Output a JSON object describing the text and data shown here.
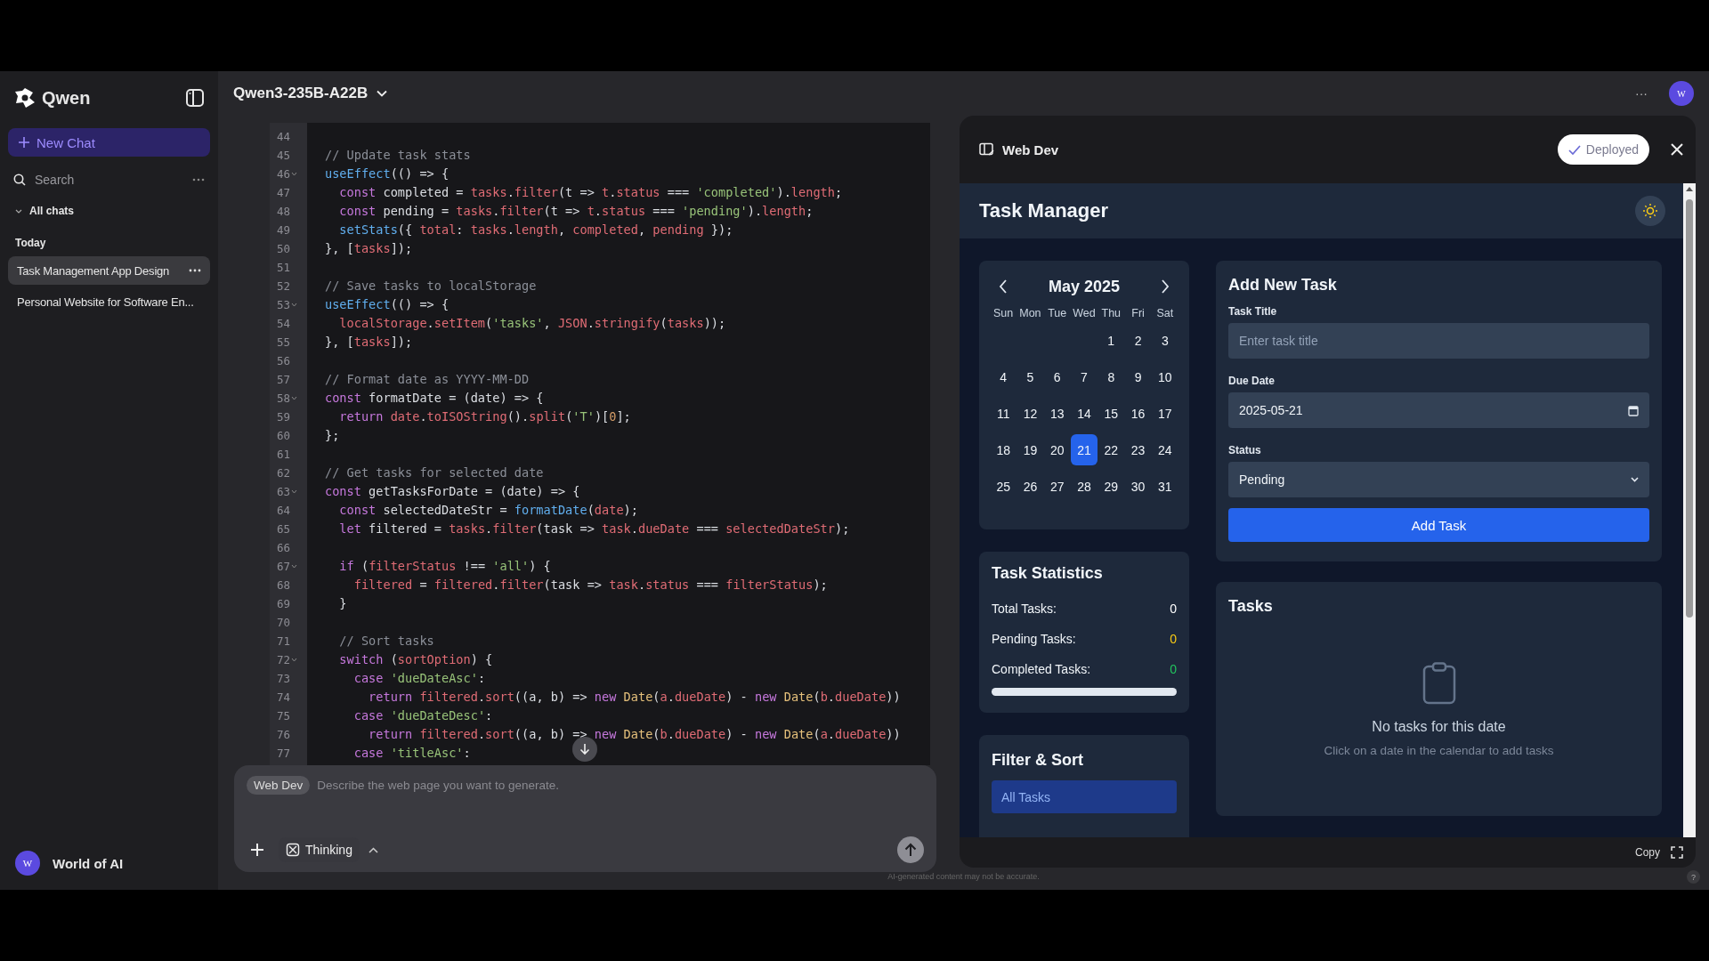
{
  "sidebar": {
    "brand": "Qwen",
    "new_chat": "New Chat",
    "search": {
      "placeholder": "Search"
    },
    "all_chats": "All chats",
    "section": "Today",
    "chats": [
      {
        "title": "Task Management App Design",
        "selected": true
      },
      {
        "title": "Personal Website for Software En...",
        "selected": false
      }
    ],
    "user": {
      "initial": "W",
      "name": "World of AI"
    }
  },
  "header": {
    "model": "Qwen3-235B-A22B",
    "more": "···",
    "avatar": "W"
  },
  "code": {
    "lines": [
      {
        "number": "44",
        "foldable": false
      },
      {
        "number": "45",
        "foldable": false,
        "tokens": [
          {
            "kind": "comment",
            "text": "// Update task stats"
          }
        ]
      },
      {
        "number": "46",
        "foldable": true,
        "tokens": [
          {
            "kind": "func",
            "text": "useEffect"
          },
          {
            "kind": "plain",
            "text": "(() => {"
          }
        ]
      },
      {
        "number": "47",
        "foldable": false,
        "tokens": [
          {
            "kind": "keyword",
            "text": "  const"
          },
          {
            "kind": "plain",
            "text": " completed = "
          },
          {
            "kind": "var",
            "text": "tasks"
          },
          {
            "kind": "plain",
            "text": "."
          },
          {
            "kind": "var",
            "text": "filter"
          },
          {
            "kind": "plain",
            "text": "(t => "
          },
          {
            "kind": "var",
            "text": "t"
          },
          {
            "kind": "plain",
            "text": "."
          },
          {
            "kind": "var",
            "text": "status"
          },
          {
            "kind": "plain",
            "text": " === "
          },
          {
            "kind": "string",
            "text": "'completed'"
          },
          {
            "kind": "plain",
            "text": ")."
          },
          {
            "kind": "var",
            "text": "length"
          },
          {
            "kind": "plain",
            "text": ";"
          }
        ]
      },
      {
        "number": "48",
        "foldable": false,
        "tokens": [
          {
            "kind": "keyword",
            "text": "  const"
          },
          {
            "kind": "plain",
            "text": " pending = "
          },
          {
            "kind": "var",
            "text": "tasks"
          },
          {
            "kind": "plain",
            "text": "."
          },
          {
            "kind": "var",
            "text": "filter"
          },
          {
            "kind": "plain",
            "text": "(t => "
          },
          {
            "kind": "var",
            "text": "t"
          },
          {
            "kind": "plain",
            "text": "."
          },
          {
            "kind": "var",
            "text": "status"
          },
          {
            "kind": "plain",
            "text": " === "
          },
          {
            "kind": "string",
            "text": "'pending'"
          },
          {
            "kind": "plain",
            "text": ")."
          },
          {
            "kind": "var",
            "text": "length"
          },
          {
            "kind": "plain",
            "text": ";"
          }
        ]
      },
      {
        "number": "49",
        "foldable": false,
        "tokens": [
          {
            "kind": "func",
            "text": "  setStats"
          },
          {
            "kind": "plain",
            "text": "({ "
          },
          {
            "kind": "var",
            "text": "total"
          },
          {
            "kind": "plain",
            "text": ": "
          },
          {
            "kind": "var",
            "text": "tasks"
          },
          {
            "kind": "plain",
            "text": "."
          },
          {
            "kind": "var",
            "text": "length"
          },
          {
            "kind": "plain",
            "text": ", "
          },
          {
            "kind": "var",
            "text": "completed"
          },
          {
            "kind": "plain",
            "text": ", "
          },
          {
            "kind": "var",
            "text": "pending"
          },
          {
            "kind": "plain",
            "text": " });"
          }
        ]
      },
      {
        "number": "50",
        "foldable": false,
        "tokens": [
          {
            "kind": "plain",
            "text": "}, ["
          },
          {
            "kind": "var",
            "text": "tasks"
          },
          {
            "kind": "plain",
            "text": "]);"
          }
        ]
      },
      {
        "number": "51",
        "foldable": false
      },
      {
        "number": "52",
        "foldable": false,
        "tokens": [
          {
            "kind": "comment",
            "text": "// Save tasks to localStorage"
          }
        ]
      },
      {
        "number": "53",
        "foldable": true,
        "tokens": [
          {
            "kind": "func",
            "text": "useEffect"
          },
          {
            "kind": "plain",
            "text": "(() => {"
          }
        ]
      },
      {
        "number": "54",
        "foldable": false,
        "tokens": [
          {
            "kind": "var",
            "text": "  localStorage"
          },
          {
            "kind": "plain",
            "text": "."
          },
          {
            "kind": "var",
            "text": "setItem"
          },
          {
            "kind": "plain",
            "text": "("
          },
          {
            "kind": "string",
            "text": "'tasks'"
          },
          {
            "kind": "plain",
            "text": ", "
          },
          {
            "kind": "var",
            "text": "JSON"
          },
          {
            "kind": "plain",
            "text": "."
          },
          {
            "kind": "var",
            "text": "stringify"
          },
          {
            "kind": "plain",
            "text": "("
          },
          {
            "kind": "var",
            "text": "tasks"
          },
          {
            "kind": "plain",
            "text": "));"
          }
        ]
      },
      {
        "number": "55",
        "foldable": false,
        "tokens": [
          {
            "kind": "plain",
            "text": "}, ["
          },
          {
            "kind": "var",
            "text": "tasks"
          },
          {
            "kind": "plain",
            "text": "]);"
          }
        ]
      },
      {
        "number": "56",
        "foldable": false
      },
      {
        "number": "57",
        "foldable": false,
        "tokens": [
          {
            "kind": "comment",
            "text": "// Format date as YYYY-MM-DD"
          }
        ]
      },
      {
        "number": "58",
        "foldable": true,
        "tokens": [
          {
            "kind": "keyword",
            "text": "const"
          },
          {
            "kind": "plain",
            "text": " formatDate = (date) => {"
          }
        ]
      },
      {
        "number": "59",
        "foldable": false,
        "tokens": [
          {
            "kind": "keyword",
            "text": "  return "
          },
          {
            "kind": "var",
            "text": "date"
          },
          {
            "kind": "plain",
            "text": "."
          },
          {
            "kind": "var",
            "text": "toISOString"
          },
          {
            "kind": "plain",
            "text": "()."
          },
          {
            "kind": "var",
            "text": "split"
          },
          {
            "kind": "plain",
            "text": "("
          },
          {
            "kind": "string",
            "text": "'T'"
          },
          {
            "kind": "plain",
            "text": ")["
          },
          {
            "kind": "number",
            "text": "0"
          },
          {
            "kind": "plain",
            "text": "];"
          }
        ]
      },
      {
        "number": "60",
        "foldable": false,
        "tokens": [
          {
            "kind": "plain",
            "text": "};"
          }
        ]
      },
      {
        "number": "61",
        "foldable": false
      },
      {
        "number": "62",
        "foldable": false,
        "tokens": [
          {
            "kind": "comment",
            "text": "// Get tasks for selected date"
          }
        ]
      },
      {
        "number": "63",
        "foldable": true,
        "tokens": [
          {
            "kind": "keyword",
            "text": "const"
          },
          {
            "kind": "plain",
            "text": " getTasksForDate = (date) => {"
          }
        ]
      },
      {
        "number": "64",
        "foldable": false,
        "tokens": [
          {
            "kind": "keyword",
            "text": "  const"
          },
          {
            "kind": "plain",
            "text": " selectedDateStr = "
          },
          {
            "kind": "func",
            "text": "formatDate"
          },
          {
            "kind": "plain",
            "text": "("
          },
          {
            "kind": "var",
            "text": "date"
          },
          {
            "kind": "plain",
            "text": ");"
          }
        ]
      },
      {
        "number": "65",
        "foldable": false,
        "tokens": [
          {
            "kind": "keyword",
            "text": "  let"
          },
          {
            "kind": "plain",
            "text": " filtered = "
          },
          {
            "kind": "var",
            "text": "tasks"
          },
          {
            "kind": "plain",
            "text": "."
          },
          {
            "kind": "var",
            "text": "filter"
          },
          {
            "kind": "plain",
            "text": "(task => "
          },
          {
            "kind": "var",
            "text": "task"
          },
          {
            "kind": "plain",
            "text": "."
          },
          {
            "kind": "var",
            "text": "dueDate"
          },
          {
            "kind": "plain",
            "text": " === "
          },
          {
            "kind": "var",
            "text": "selectedDateStr"
          },
          {
            "kind": "plain",
            "text": ");"
          }
        ]
      },
      {
        "number": "66",
        "foldable": false
      },
      {
        "number": "67",
        "foldable": true,
        "tokens": [
          {
            "kind": "keyword",
            "text": "  if"
          },
          {
            "kind": "plain",
            "text": " ("
          },
          {
            "kind": "var",
            "text": "filterStatus"
          },
          {
            "kind": "plain",
            "text": " !== "
          },
          {
            "kind": "string",
            "text": "'all'"
          },
          {
            "kind": "plain",
            "text": ") {"
          }
        ]
      },
      {
        "number": "68",
        "foldable": false,
        "tokens": [
          {
            "kind": "var",
            "text": "    filtered"
          },
          {
            "kind": "plain",
            "text": " = "
          },
          {
            "kind": "var",
            "text": "filtered"
          },
          {
            "kind": "plain",
            "text": "."
          },
          {
            "kind": "var",
            "text": "filter"
          },
          {
            "kind": "plain",
            "text": "(task => "
          },
          {
            "kind": "var",
            "text": "task"
          },
          {
            "kind": "plain",
            "text": "."
          },
          {
            "kind": "var",
            "text": "status"
          },
          {
            "kind": "plain",
            "text": " === "
          },
          {
            "kind": "var",
            "text": "filterStatus"
          },
          {
            "kind": "plain",
            "text": ");"
          }
        ]
      },
      {
        "number": "69",
        "foldable": false,
        "tokens": [
          {
            "kind": "plain",
            "text": "  }"
          }
        ]
      },
      {
        "number": "70",
        "foldable": false
      },
      {
        "number": "71",
        "foldable": false,
        "tokens": [
          {
            "kind": "comment",
            "text": "  // Sort tasks"
          }
        ]
      },
      {
        "number": "72",
        "foldable": true,
        "tokens": [
          {
            "kind": "keyword",
            "text": "  switch"
          },
          {
            "kind": "plain",
            "text": " ("
          },
          {
            "kind": "var",
            "text": "sortOption"
          },
          {
            "kind": "plain",
            "text": ") {"
          }
        ]
      },
      {
        "number": "73",
        "foldable": false,
        "tokens": [
          {
            "kind": "keyword",
            "text": "    case "
          },
          {
            "kind": "string",
            "text": "'dueDateAsc'"
          },
          {
            "kind": "plain",
            "text": ":"
          }
        ]
      },
      {
        "number": "74",
        "foldable": false,
        "tokens": [
          {
            "kind": "keyword",
            "text": "      return "
          },
          {
            "kind": "var",
            "text": "filtered"
          },
          {
            "kind": "plain",
            "text": "."
          },
          {
            "kind": "var",
            "text": "sort"
          },
          {
            "kind": "plain",
            "text": "((a, b) => "
          },
          {
            "kind": "keyword",
            "text": "new "
          },
          {
            "kind": "class",
            "text": "Date"
          },
          {
            "kind": "plain",
            "text": "("
          },
          {
            "kind": "var",
            "text": "a"
          },
          {
            "kind": "plain",
            "text": "."
          },
          {
            "kind": "var",
            "text": "dueDate"
          },
          {
            "kind": "plain",
            "text": ") - "
          },
          {
            "kind": "keyword",
            "text": "new "
          },
          {
            "kind": "class",
            "text": "Date"
          },
          {
            "kind": "plain",
            "text": "("
          },
          {
            "kind": "var",
            "text": "b"
          },
          {
            "kind": "plain",
            "text": "."
          },
          {
            "kind": "var",
            "text": "dueDate"
          },
          {
            "kind": "plain",
            "text": "))"
          }
        ]
      },
      {
        "number": "75",
        "foldable": false,
        "tokens": [
          {
            "kind": "keyword",
            "text": "    case "
          },
          {
            "kind": "string",
            "text": "'dueDateDesc'"
          },
          {
            "kind": "plain",
            "text": ":"
          }
        ]
      },
      {
        "number": "76",
        "foldable": false,
        "tokens": [
          {
            "kind": "keyword",
            "text": "      return "
          },
          {
            "kind": "var",
            "text": "filtered"
          },
          {
            "kind": "plain",
            "text": "."
          },
          {
            "kind": "var",
            "text": "sort"
          },
          {
            "kind": "plain",
            "text": "((a, b) => "
          },
          {
            "kind": "keyword",
            "text": "new "
          },
          {
            "kind": "class",
            "text": "Date"
          },
          {
            "kind": "plain",
            "text": "("
          },
          {
            "kind": "var",
            "text": "b"
          },
          {
            "kind": "plain",
            "text": "."
          },
          {
            "kind": "var",
            "text": "dueDate"
          },
          {
            "kind": "plain",
            "text": ") - "
          },
          {
            "kind": "keyword",
            "text": "new "
          },
          {
            "kind": "class",
            "text": "Date"
          },
          {
            "kind": "plain",
            "text": "("
          },
          {
            "kind": "var",
            "text": "a"
          },
          {
            "kind": "plain",
            "text": "."
          },
          {
            "kind": "var",
            "text": "dueDate"
          },
          {
            "kind": "plain",
            "text": "))"
          }
        ]
      },
      {
        "number": "77",
        "foldable": false,
        "tokens": [
          {
            "kind": "keyword",
            "text": "    case "
          },
          {
            "kind": "string",
            "text": "'titleAsc'"
          },
          {
            "kind": "plain",
            "text": ":"
          }
        ]
      }
    ]
  },
  "prompt": {
    "mode_chip": "Web Dev",
    "placeholder": "Describe the web page you want to generate.",
    "thinking": "Thinking"
  },
  "disclaimer": "AI-generated content may not be accurate.",
  "help": "?",
  "preview": {
    "title": "Web Dev",
    "status": "Deployed",
    "copy": "Copy",
    "app": {
      "title": "Task Manager",
      "calendar": {
        "month": "May 2025",
        "weekdays": [
          "Sun",
          "Mon",
          "Tue",
          "Wed",
          "Thu",
          "Fri",
          "Sat"
        ],
        "weeks": [
          {
            "days": [
              {
                "day": "1",
                "selected": false
              },
              {
                "day": "2",
                "selected": false
              },
              {
                "day": "3",
                "selected": false
              }
            ]
          },
          {
            "days": [
              {
                "day": "4",
                "selected": false
              },
              {
                "day": "5",
                "selected": false
              },
              {
                "day": "6",
                "selected": false
              },
              {
                "day": "7",
                "selected": false
              },
              {
                "day": "8",
                "selected": false
              },
              {
                "day": "9",
                "selected": false
              },
              {
                "day": "10",
                "selected": false
              }
            ]
          },
          {
            "days": [
              {
                "day": "11",
                "selected": false
              },
              {
                "day": "12",
                "selected": false
              },
              {
                "day": "13",
                "selected": false
              },
              {
                "day": "14",
                "selected": false
              },
              {
                "day": "15",
                "selected": false
              },
              {
                "day": "16",
                "selected": false
              },
              {
                "day": "17",
                "selected": false
              }
            ]
          },
          {
            "days": [
              {
                "day": "18",
                "selected": false
              },
              {
                "day": "19",
                "selected": false
              },
              {
                "day": "20",
                "selected": false
              },
              {
                "day": "21",
                "selected": true
              },
              {
                "day": "22",
                "selected": false
              },
              {
                "day": "23",
                "selected": false
              },
              {
                "day": "24",
                "selected": false
              }
            ]
          },
          {
            "days": [
              {
                "day": "25",
                "selected": false
              },
              {
                "day": "26",
                "selected": false
              },
              {
                "day": "27",
                "selected": false
              },
              {
                "day": "28",
                "selected": false
              },
              {
                "day": "29",
                "selected": false
              },
              {
                "day": "30",
                "selected": false
              },
              {
                "day": "31",
                "selected": false
              }
            ]
          }
        ]
      },
      "statistics": {
        "title": "Task Statistics",
        "rows": [
          {
            "label": "Total Tasks:",
            "value": "0",
            "color": "#ffffff"
          },
          {
            "label": "Pending Tasks:",
            "value": "0",
            "color": "#facc15"
          },
          {
            "label": "Completed Tasks:",
            "value": "0",
            "color": "#22c55e"
          }
        ],
        "progress": {
          "level": 0
        }
      },
      "filter": {
        "title": "Filter & Sort",
        "options": [
          {
            "label": "All Tasks",
            "selected": true
          }
        ]
      },
      "form": {
        "title": "Add New Task",
        "fields": [
          {
            "kind": "text",
            "label": "Task Title",
            "placeholder": "Enter task title"
          },
          {
            "kind": "date",
            "label": "Due Date",
            "value": "2025-05-21"
          },
          {
            "kind": "select",
            "label": "Status",
            "value": "Pending"
          }
        ],
        "submit": "Add Task"
      },
      "tasks": {
        "title": "Tasks",
        "empty_title": "No tasks for this date",
        "empty_hint": "Click on a date in the calendar to add tasks"
      }
    }
  }
}
